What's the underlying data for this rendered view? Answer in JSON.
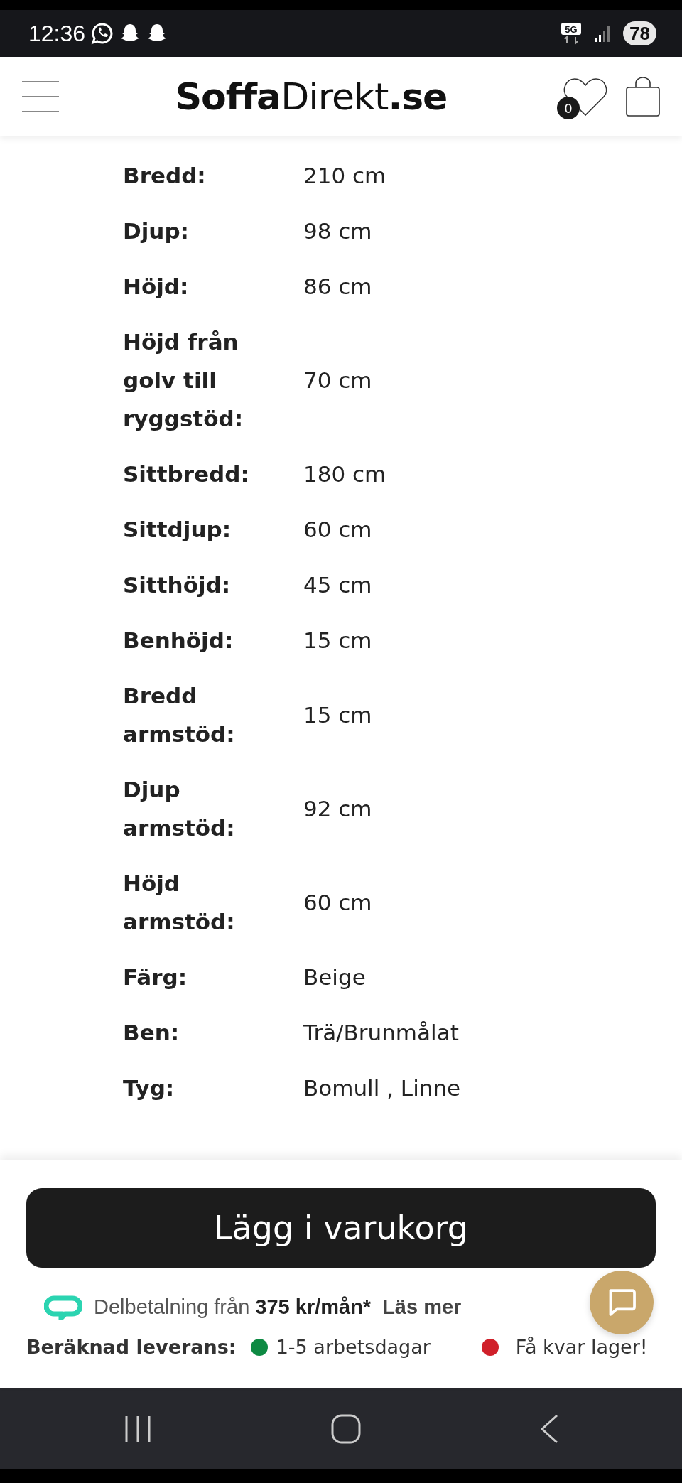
{
  "status_bar": {
    "time": "12:36",
    "network": "5G",
    "battery": "78"
  },
  "header": {
    "logo": "**Soffa**Direkt**.se**",
    "wishlist_count": "0"
  },
  "specs": [
    {
      "label": "Bredd:",
      "value": "210 cm"
    },
    {
      "label": "Djup:",
      "value": "98 cm"
    },
    {
      "label": "Höjd:",
      "value": "86 cm"
    },
    {
      "label": "Höjd från golv till ryggstöd:",
      "value": "70 cm"
    },
    {
      "label": "Sittbredd:",
      "value": "180 cm"
    },
    {
      "label": "Sittdjup:",
      "value": "60 cm"
    },
    {
      "label": "Sitthöjd:",
      "value": "45 cm"
    },
    {
      "label": "Benhöjd:",
      "value": "15 cm"
    },
    {
      "label": "Bredd armstöd:",
      "value": "15 cm"
    },
    {
      "label": "Djup armstöd:",
      "value": "92 cm"
    },
    {
      "label": "Höjd armstöd:",
      "value": "60 cm"
    },
    {
      "label": "Färg:",
      "value": "Beige"
    },
    {
      "label": "Ben:",
      "value": "Trä/Brunmålat"
    },
    {
      "label": "Tyg:",
      "value": "Bomull , Linne"
    }
  ],
  "add_to_cart": "Lägg i varukorg",
  "installment": {
    "prefix": "Delbetalning från",
    "amount": "375 kr/mån*",
    "link": "Läs mer"
  },
  "delivery": {
    "label": "Beräknad leverans:",
    "items": [
      {
        "color": "#0e8a43",
        "text": "1-5 arbetsdagar"
      },
      {
        "color": "#d0202a",
        "text": "Få kvar lager!"
      }
    ]
  }
}
